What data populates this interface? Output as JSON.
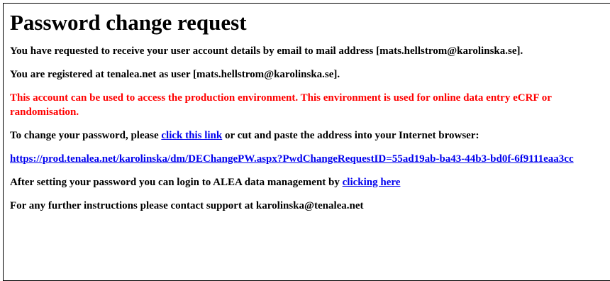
{
  "email": {
    "title": "Password change request",
    "line_requested": "You have requested to receive your user account details by email to mail address [mats.hellstrom@karolinska.se].",
    "line_registered": "You are registered at tenalea.net as user [mats.hellstrom@karolinska.se].",
    "warning": "This account can be used to access the production environment. This environment is used for online data entry eCRF or randomisation.",
    "change_prefix": "To change your password, please ",
    "change_link_label": "click this link",
    "change_suffix": " or cut and paste the address into your Internet browser:",
    "reset_url": "https://prod.tenalea.net/karolinska/dm/DEChangePW.aspx?PwdChangeRequestID=55ad19ab-ba43-44b3-bd0f-6f9111eaa3cc",
    "login_prefix": "After setting your password you can login to ALEA data management by ",
    "login_link_label": "clicking here",
    "support_line": "For any further instructions please contact support at karolinska@tenalea.net"
  }
}
